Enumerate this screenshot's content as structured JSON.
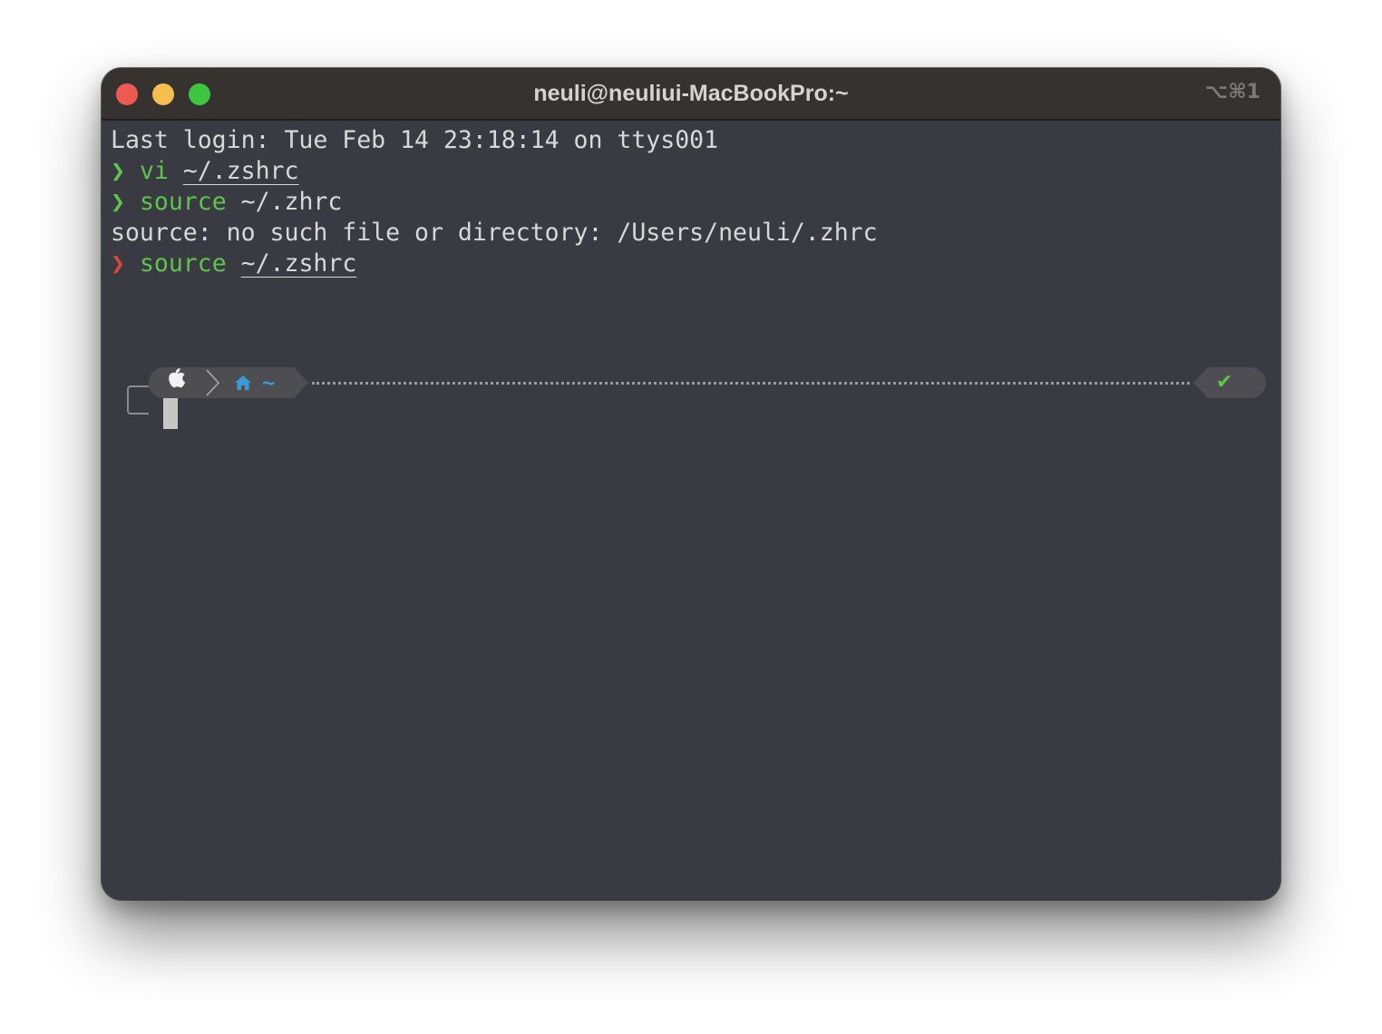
{
  "window": {
    "title": "neuli@neuliui-MacBookPro:~",
    "shortcut": "⌥⌘1"
  },
  "terminal": {
    "last_login": "Last login: Tue Feb 14 23:18:14 on ttys001",
    "commands": [
      {
        "prompt": "❯",
        "status": "success",
        "command": "vi",
        "argument": "~/.zshrc"
      },
      {
        "prompt": "❯",
        "status": "success",
        "command": "source",
        "argument": "~/.zhrc"
      },
      {
        "prompt": "❯",
        "status": "error",
        "command": "source",
        "argument": "~/.zshrc"
      }
    ],
    "error_output": "source: no such file or directory: /Users/neuli/.zhrc"
  },
  "prompt": {
    "os_icon": "apple-icon",
    "dir_icon": "home-icon",
    "directory": "~",
    "status_symbol": "✔"
  },
  "colors": {
    "background": "#3a3a43",
    "titlebar": "#363230",
    "prompt_success": "#5ec44c",
    "prompt_error": "#e0443a",
    "directory": "#3a9ad6",
    "segment_bg": "#4d4d52"
  }
}
